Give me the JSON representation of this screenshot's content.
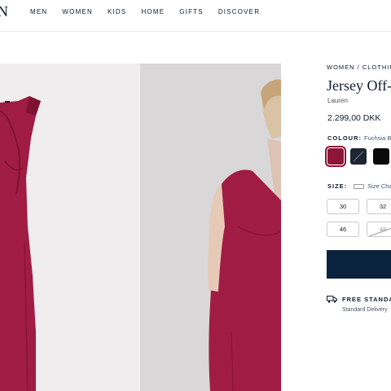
{
  "header": {
    "logo_fragment": "N",
    "nav": [
      "MEN",
      "WOMEN",
      "KIDS",
      "HOME",
      "GIFTS",
      "DISCOVER"
    ]
  },
  "product": {
    "breadcrumb": "WOMEN / CLOTHING",
    "title": "Jersey Off-",
    "brand": "Lauren",
    "price": "2.299,00 DKK",
    "colour_label": "COLOUR:",
    "colour_value": "Fuchsia Be",
    "swatches": [
      {
        "name": "fuchsia",
        "color": "#8c1538",
        "selected": true
      },
      {
        "name": "navy",
        "color": "#1f2433",
        "selected": false
      },
      {
        "name": "black",
        "color": "#0b0b0b",
        "selected": false
      }
    ],
    "size_label": "SIZE:",
    "size_chart": "Size Chart",
    "sizes": [
      {
        "label": "30",
        "available": true
      },
      {
        "label": "32",
        "available": true
      },
      {
        "label": "46",
        "available": true
      },
      {
        "label": "48",
        "available": false
      }
    ],
    "shipping_title": "FREE STANDAR",
    "shipping_sub": "Standard Delivery"
  },
  "colors": {
    "navy": "#0c2340",
    "dress": "#a01c44"
  }
}
